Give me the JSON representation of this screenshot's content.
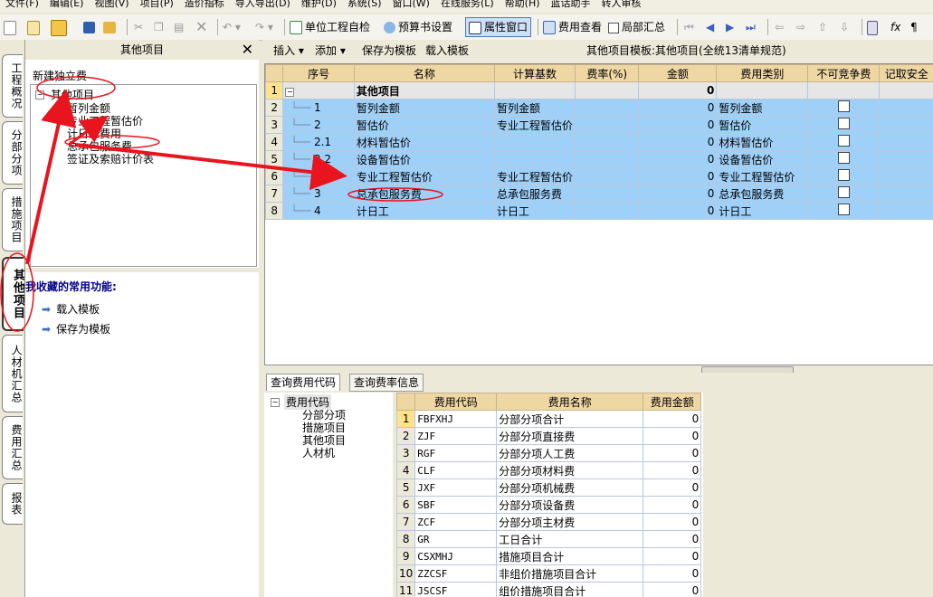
{
  "menu": [
    "文件(F)",
    "编辑(E)",
    "视图(V)",
    "项目(P)",
    "造价指标",
    "导入导出(D)",
    "维护(D)",
    "系统(S)",
    "窗口(W)",
    "在线服务(L)",
    "帮助(H)",
    "蓝话助手",
    "转人审核"
  ],
  "toolbar": {
    "unit_check": "单位工程自检",
    "budget_settings": "预算书设置",
    "property_window": "属性窗口",
    "fee_view": "费用查看",
    "partial_summary": "局部汇总"
  },
  "vtabs": [
    "工程概况",
    "分部分项",
    "措施项目",
    "其他项目",
    "人材机汇总",
    "费用汇总",
    "报表"
  ],
  "left_panel": {
    "title": "其他项目",
    "close": "✕",
    "new_fee": "新建独立费",
    "tree_root": "其他项目",
    "tree_children": [
      "暂列金额",
      "专业工程暂估价",
      "计日工费用",
      "总承包服务费",
      "签证及索赔计价表"
    ],
    "fav_title": "我收藏的常用功能:",
    "fav_items": [
      "载入模板",
      "保存为模板"
    ]
  },
  "right_toolbar": {
    "insert": "插入",
    "add": "添加",
    "save_template": "保存为模板",
    "load_template": "载入模板",
    "template_info": "其他项目模板:其他项目(全统13清单规范)"
  },
  "grid": {
    "columns": [
      "序号",
      "名称",
      "计算基数",
      "费率(%)",
      "金额",
      "费用类别",
      "不可竞争费",
      "记取安全"
    ],
    "rows": [
      {
        "n": "1",
        "seq": "",
        "name": "其他项目",
        "base": "",
        "rate": "",
        "amount": "0",
        "cat": "",
        "chk": false,
        "root": true
      },
      {
        "n": "2",
        "seq": "1",
        "name": "暂列金额",
        "base": "暂列金额",
        "rate": "",
        "amount": "0",
        "cat": "暂列金额",
        "chk": true
      },
      {
        "n": "3",
        "seq": "2",
        "name": "暂估价",
        "base": "专业工程暂估价",
        "rate": "",
        "amount": "0",
        "cat": "暂估价",
        "chk": true
      },
      {
        "n": "4",
        "seq": "2.1",
        "name": "材料暂估价",
        "base": "",
        "rate": "",
        "amount": "0",
        "cat": "材料暂估价",
        "chk": true
      },
      {
        "n": "5",
        "seq": "2.2",
        "name": "设备暂估价",
        "base": "",
        "rate": "",
        "amount": "0",
        "cat": "设备暂估价",
        "chk": true
      },
      {
        "n": "6",
        "seq": "2.3",
        "name": "专业工程暂估价",
        "base": "专业工程暂估价",
        "rate": "",
        "amount": "0",
        "cat": "专业工程暂估价",
        "chk": true
      },
      {
        "n": "7",
        "seq": "3",
        "name": "总承包服务费",
        "base": "总承包服务费",
        "rate": "",
        "amount": "0",
        "cat": "总承包服务费",
        "chk": true
      },
      {
        "n": "8",
        "seq": "4",
        "name": "计日工",
        "base": "计日工",
        "rate": "",
        "amount": "0",
        "cat": "计日工",
        "chk": true
      }
    ]
  },
  "bottom_tabs": [
    "查询费用代码",
    "查询费率信息"
  ],
  "bottom_tree": {
    "root": "费用代码",
    "children": [
      "分部分项",
      "措施项目",
      "其他项目",
      "人材机"
    ]
  },
  "bottom_grid": {
    "columns": [
      "费用代码",
      "费用名称",
      "费用金额"
    ],
    "rows": [
      {
        "n": "1",
        "code": "FBFXHJ",
        "name": "分部分项合计",
        "amount": "0"
      },
      {
        "n": "2",
        "code": "ZJF",
        "name": "分部分项直接费",
        "amount": "0"
      },
      {
        "n": "3",
        "code": "RGF",
        "name": "分部分项人工费",
        "amount": "0"
      },
      {
        "n": "4",
        "code": "CLF",
        "name": "分部分项材料费",
        "amount": "0"
      },
      {
        "n": "5",
        "code": "JXF",
        "name": "分部分项机械费",
        "amount": "0"
      },
      {
        "n": "6",
        "code": "SBF",
        "name": "分部分项设备费",
        "amount": "0"
      },
      {
        "n": "7",
        "code": "ZCF",
        "name": "分部分项主材费",
        "amount": "0"
      },
      {
        "n": "8",
        "code": "GR",
        "name": "工日合计",
        "amount": "0"
      },
      {
        "n": "9",
        "code": "CSXMHJ",
        "name": "措施项目合计",
        "amount": "0"
      },
      {
        "n": "10",
        "code": "ZZCSF",
        "name": "非组价措施项目合计",
        "amount": "0"
      },
      {
        "n": "11",
        "code": "JSCSF",
        "name": "组价措施项目合计",
        "amount": "0"
      }
    ]
  },
  "colors": {
    "highlight_blue": "#9fd0f8",
    "header_tan": "#efd7a4",
    "annotation_red": "#e8141e"
  }
}
